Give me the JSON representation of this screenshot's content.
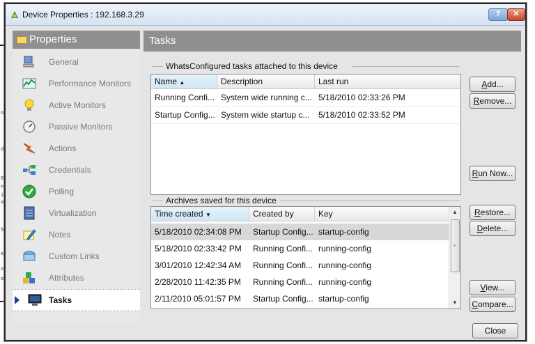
{
  "window": {
    "title": "Device Properties : 192.168.3.29",
    "help_label": "?",
    "close_label": "✕"
  },
  "background_fragments": [
    "on",
    "di",
    "0",
    "n",
    "i",
    "a",
    "5",
    "s",
    "o",
    "o"
  ],
  "nav": {
    "header": "Properties",
    "items": [
      {
        "label": "General",
        "icon": "computer-icon"
      },
      {
        "label": "Performance Monitors",
        "icon": "chart-icon"
      },
      {
        "label": "Active Monitors",
        "icon": "lightbulb-icon"
      },
      {
        "label": "Passive Monitors",
        "icon": "gauge-icon"
      },
      {
        "label": "Actions",
        "icon": "lightning-icon"
      },
      {
        "label": "Credentials",
        "icon": "network-icon"
      },
      {
        "label": "Polling",
        "icon": "check-icon"
      },
      {
        "label": "Virtualization",
        "icon": "server-icon"
      },
      {
        "label": "Notes",
        "icon": "pencil-icon"
      },
      {
        "label": "Custom Links",
        "icon": "links-icon"
      },
      {
        "label": "Attributes",
        "icon": "blocks-icon"
      },
      {
        "label": "Tasks",
        "icon": "monitor-icon",
        "selected": true
      }
    ]
  },
  "main": {
    "title": "Tasks",
    "tasks_group": {
      "label": "WhatsConfigured tasks attached to this device",
      "columns": [
        "Name",
        "Description",
        "Last run"
      ],
      "sort_indicator": "▲",
      "rows": [
        [
          "Running Confi...",
          "System wide running c...",
          "5/18/2010 02:33:26 PM"
        ],
        [
          "Startup Config...",
          "System wide startup c...",
          "5/18/2010 02:33:52 PM"
        ]
      ]
    },
    "archives_group": {
      "label": "Archives saved for this device",
      "columns": [
        "Time created",
        "Created by",
        "Key"
      ],
      "sort_indicator": "▼",
      "rows": [
        [
          "5/18/2010 02:34:08 PM",
          "Startup Config...",
          "startup-config"
        ],
        [
          "5/18/2010 02:33:42 PM",
          "Running Confi...",
          "running-config"
        ],
        [
          "3/01/2010 12:42:34 AM",
          "Running Confi...",
          "running-config"
        ],
        [
          "2/28/2010 11:42:35 PM",
          "Running Confi...",
          "running-config"
        ],
        [
          "2/11/2010 05:01:57 PM",
          "Startup Config...",
          "startup-config"
        ]
      ],
      "selected_row": 0
    },
    "buttons": {
      "add": {
        "underlined": "A",
        "rest": "dd..."
      },
      "remove": {
        "underlined": "R",
        "rest": "emove..."
      },
      "run_now": {
        "underlined": "R",
        "rest": "un Now..."
      },
      "restore": {
        "underlined": "R",
        "rest": "estore..."
      },
      "delete": {
        "underlined": "D",
        "rest": "elete..."
      },
      "view": {
        "underlined": "V",
        "rest": "iew..."
      },
      "compare": {
        "underlined": "C",
        "rest": "ompare..."
      },
      "close": "Close"
    }
  }
}
